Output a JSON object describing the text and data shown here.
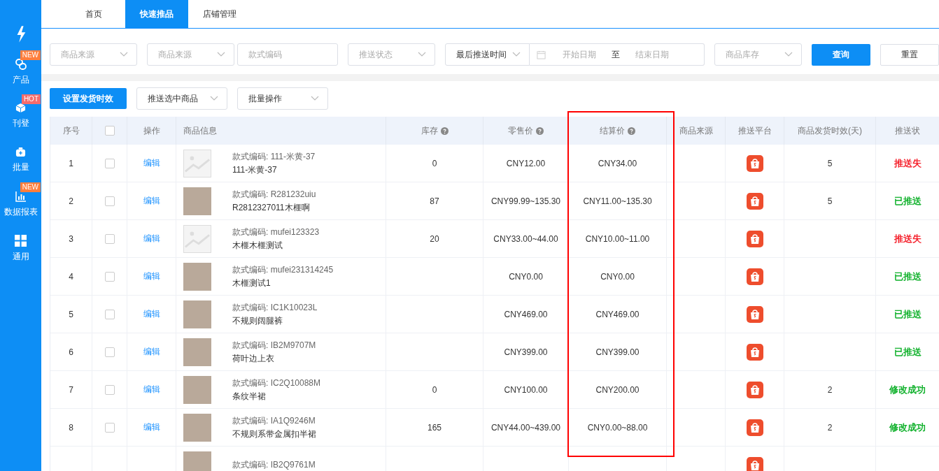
{
  "sidebar": {
    "items": [
      {
        "label": "产品",
        "badge": {
          "text": "NEW",
          "color": "#ff7e3d"
        }
      },
      {
        "label": "刊登",
        "badge": {
          "text": "HOT",
          "color": "#f56c6c"
        }
      },
      {
        "label": "批量"
      },
      {
        "label": "数据报表",
        "badge": {
          "text": "NEW",
          "color": "#ff7e3d"
        }
      },
      {
        "label": "通用"
      }
    ]
  },
  "tabs": [
    {
      "label": "首页",
      "selected": false
    },
    {
      "label": "快速推品",
      "selected": true
    },
    {
      "label": "店铺管理",
      "selected": false
    }
  ],
  "filters": [
    {
      "kind": "select",
      "placeholder": "商品来源"
    },
    {
      "kind": "select",
      "placeholder": "商品来源"
    },
    {
      "kind": "input",
      "placeholder": "款式编码"
    },
    {
      "kind": "select",
      "placeholder": "推送状态"
    },
    {
      "kind": "daterange",
      "value": "最后推送时间",
      "start_placeholder": "开始日期",
      "separator": "至",
      "end_placeholder": "结束日期"
    },
    {
      "kind": "select",
      "placeholder": "商品库存"
    }
  ],
  "filter_buttons": [
    {
      "label": "查询",
      "primary": true
    },
    {
      "label": "重置",
      "primary": false
    }
  ],
  "toolbar": [
    {
      "kind": "button",
      "label": "设置发货时效"
    },
    {
      "kind": "dropdown",
      "label": "推送选中商品"
    },
    {
      "kind": "dropdown",
      "label": "批量操作"
    }
  ],
  "table": {
    "columns": [
      {
        "label": "序号",
        "help": false,
        "highlighted": false
      },
      {
        "kind": "checkbox",
        "checked": false,
        "help": false,
        "highlighted": false
      },
      {
        "label": "操作",
        "help": false,
        "highlighted": false
      },
      {
        "label": "商品信息",
        "help": false,
        "highlighted": false
      },
      {
        "label": "库存",
        "help": true,
        "highlighted": false
      },
      {
        "label": "零售价",
        "help": true,
        "highlighted": false
      },
      {
        "label": "结算价",
        "help": true,
        "highlighted": true
      },
      {
        "label": "商品来源",
        "help": false,
        "highlighted": false
      },
      {
        "label": "推送平台",
        "help": false,
        "highlighted": false
      },
      {
        "label": "商品发货时效(天)",
        "help": false,
        "highlighted": false
      },
      {
        "label": "推送状",
        "help": false,
        "highlighted": false
      }
    ],
    "rows": [
      {
        "kind": "no_image",
        "no": "1",
        "checked": false,
        "action": "编辑",
        "code": "款式编码: 111-米黄-37",
        "name": "111-米黄-37",
        "stock": "0",
        "retail": "CNY12.00",
        "settle": "CNY34.00",
        "platform": true,
        "days": "5",
        "status": {
          "text": "推送失",
          "color": "#f5222d"
        }
      },
      {
        "kind": "photo",
        "no": "2",
        "checked": false,
        "action": "编辑",
        "code": "款式编码: R281232uiu",
        "name": "R2812327011木榧啊",
        "stock": "87",
        "retail": "CNY99.99~135.30",
        "settle": "CNY11.00~135.30",
        "platform": true,
        "days": "5",
        "status": {
          "text": "已推送",
          "color": "#13b22e"
        }
      },
      {
        "kind": "no_image",
        "no": "3",
        "checked": false,
        "action": "编辑",
        "code": "款式编码: mufei123323",
        "name": "木榧木榧测试",
        "stock": "20",
        "retail": "CNY33.00~44.00",
        "settle": "CNY10.00~11.00",
        "platform": true,
        "status": {
          "text": "推送失",
          "color": "#f5222d"
        }
      },
      {
        "kind": "photo",
        "no": "4",
        "checked": false,
        "action": "编辑",
        "code": "款式编码: mufei231314245",
        "name": "木榧测试1",
        "retail": "CNY0.00",
        "settle": "CNY0.00",
        "platform": true,
        "status": {
          "text": "已推送",
          "color": "#13b22e"
        }
      },
      {
        "kind": "photo",
        "no": "5",
        "checked": false,
        "action": "编辑",
        "code": "款式编码: IC1K10023L",
        "name": "不规则阔腿裤",
        "retail": "CNY469.00",
        "settle": "CNY469.00",
        "platform": true,
        "status": {
          "text": "已推送",
          "color": "#13b22e"
        }
      },
      {
        "kind": "photo",
        "no": "6",
        "checked": false,
        "action": "编辑",
        "code": "款式编码: IB2M9707M",
        "name": "荷叶边上衣",
        "retail": "CNY399.00",
        "settle": "CNY399.00",
        "platform": true,
        "status": {
          "text": "已推送",
          "color": "#13b22e"
        }
      },
      {
        "kind": "photo",
        "no": "7",
        "checked": false,
        "action": "编辑",
        "code": "款式编码: IC2Q10088M",
        "name": "条纹半裙",
        "stock": "0",
        "retail": "CNY100.00",
        "settle": "CNY200.00",
        "platform": true,
        "days": "2",
        "status": {
          "text": "修改成功",
          "color": "#13b22e"
        }
      },
      {
        "kind": "photo",
        "no": "8",
        "checked": false,
        "action": "编辑",
        "code": "款式编码: IA1Q9246M",
        "name": "不规则系带金属扣半裙",
        "stock": "165",
        "retail": "CNY44.00~439.00",
        "settle": "CNY0.00~88.00",
        "platform": true,
        "days": "2",
        "status": {
          "text": "修改成功",
          "color": "#13b22e"
        }
      },
      {
        "kind": "photo",
        "code": "款式编码: IB2Q9761M",
        "platform": true
      }
    ]
  }
}
